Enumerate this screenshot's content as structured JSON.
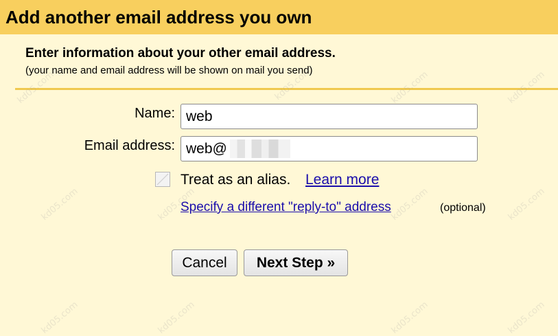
{
  "dialog": {
    "title": "Add another email address you own",
    "heading": "Enter information about your other email address.",
    "subheading": "(your name and email address will be shown on mail you send)"
  },
  "form": {
    "name_label": "Name:",
    "name_value": "web",
    "email_label": "Email address:",
    "email_value": "web@ .com",
    "alias_checkbox": {
      "checked": false,
      "label": "Treat as an alias.",
      "link": "Learn more"
    },
    "reply_to_link": "Specify a different \"reply-to\" address",
    "reply_to_note": "(optional)"
  },
  "buttons": {
    "cancel": "Cancel",
    "next": "Next Step »"
  },
  "watermark": {
    "text": "kd05.com"
  },
  "colors": {
    "title_bar": "#f8cf5e",
    "background": "#fff8d6",
    "divider": "#f0c94f",
    "link": "#1a0dab"
  }
}
